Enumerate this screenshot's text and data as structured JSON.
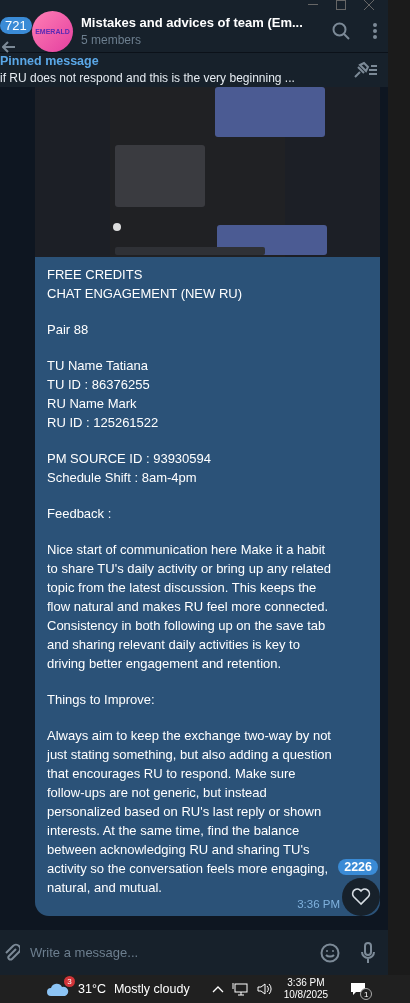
{
  "header": {
    "unread_badge": "721",
    "avatar_text": "EMERALD",
    "title": "Mistakes and advices of team (Em...",
    "subtitle": "5 members"
  },
  "pinned": {
    "label": "Pinned message",
    "text": "if RU does not respond and this is the very beginning ..."
  },
  "message": {
    "paragraphs": [
      "FREE CREDITS\nCHAT ENGAGEMENT (NEW RU)",
      "Pair 88",
      "TU Name Tatiana\nTU ID : 86376255\nRU Name Mark\nRU ID : 125261522",
      "PM SOURCE ID    :  93930594\nSchedule Shift : 8am-4pm",
      "Feedback :",
      "Nice start of communication here  Make it a habit to share TU's daily activity or bring up any related topic from the latest discussion. This keeps the flow natural and makes RU feel more connected. Consistency in both following up on the save tab and sharing relevant daily activities is key to driving better engagement and retention.",
      "Things to Improve:",
      "Always aim to keep the exchange two-way by not just stating something, but also adding a question that encourages RU to respond. Make sure follow-ups are not generic, but instead personalized based on RU's last reply or shown interests. At the same time, find the balance between acknowledging RU and sharing TU's activity so the conversation feels more engaging, natural, and mutual."
    ],
    "time": "3:36 PM"
  },
  "scroll_badge": "2226",
  "composer": {
    "placeholder": "Write a message..."
  },
  "taskbar": {
    "weather_badge": "3",
    "temperature": "31°C",
    "weather": "Mostly cloudy",
    "time": "3:36 PM",
    "date": "10/8/2025",
    "notification_count": "1"
  }
}
